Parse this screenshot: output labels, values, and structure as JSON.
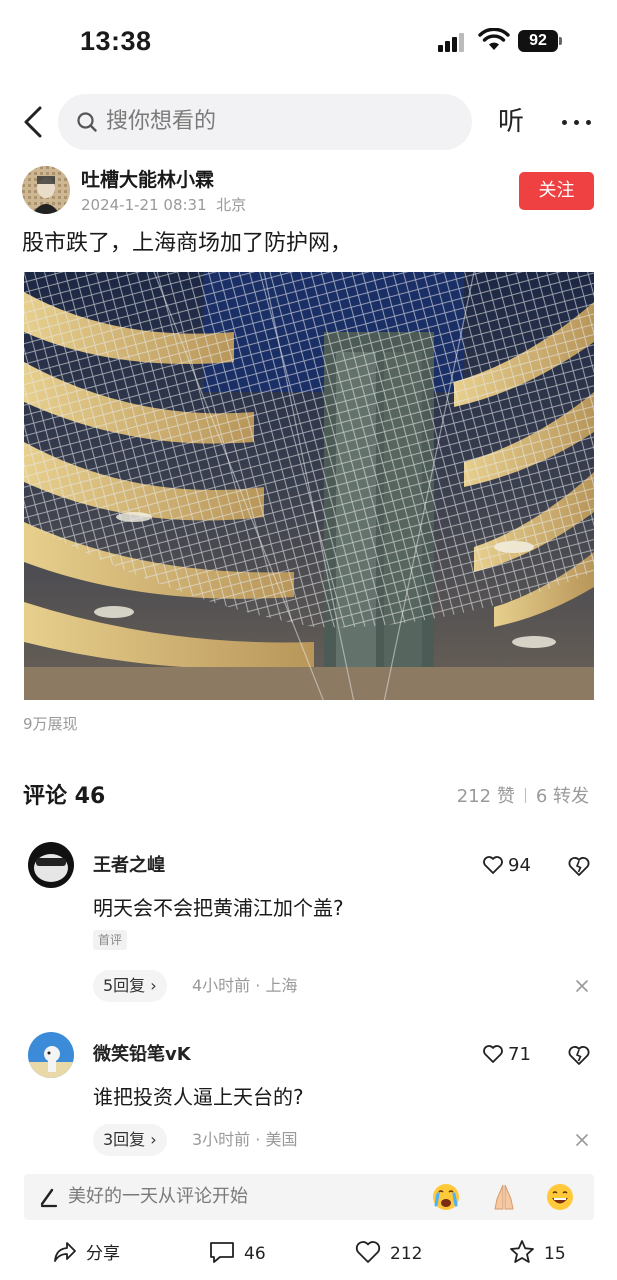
{
  "status_bar": {
    "time": "13:38",
    "battery": "92"
  },
  "nav": {
    "search_placeholder": "搜你想看的",
    "listen_label": "听",
    "icons": [
      "back-icon",
      "search-icon",
      "more-icon"
    ]
  },
  "post": {
    "author": "吐槽大能林小霖",
    "date": "2024-1-21 08:31",
    "location": "北京",
    "follow_label": "关注",
    "text": "股市跌了，上海商场加了防护网，",
    "view_count": "9万展现"
  },
  "comments_header": {
    "title": "评论 46",
    "likes": "212 赞",
    "shares": "6 转发"
  },
  "comments": [
    {
      "user": "王者之崲",
      "likes": "94",
      "text": "明天会不会把黄浦江加个盖?",
      "tag": "首评",
      "replies": "5回复 ›",
      "meta": "4小时前 · 上海"
    },
    {
      "user": "微笑铅笔vK",
      "likes": "71",
      "text": "谁把投资人逼上天台的?",
      "tag": "",
      "replies": "3回复 ›",
      "meta": "3小时前 · 美国"
    }
  ],
  "input_bar": {
    "placeholder": "美好的一天从评论开始",
    "emojis": [
      "crying-emoji",
      "praying-hands-emoji",
      "laughing-emoji"
    ]
  },
  "bottom_actions": {
    "share_label": "分享",
    "comment_count": "46",
    "like_count": "212",
    "favorite_count": "15"
  },
  "colors": {
    "accent": "#f04142",
    "secondary_text": "#9a9a9a",
    "input_bg": "#f4f4f5"
  }
}
